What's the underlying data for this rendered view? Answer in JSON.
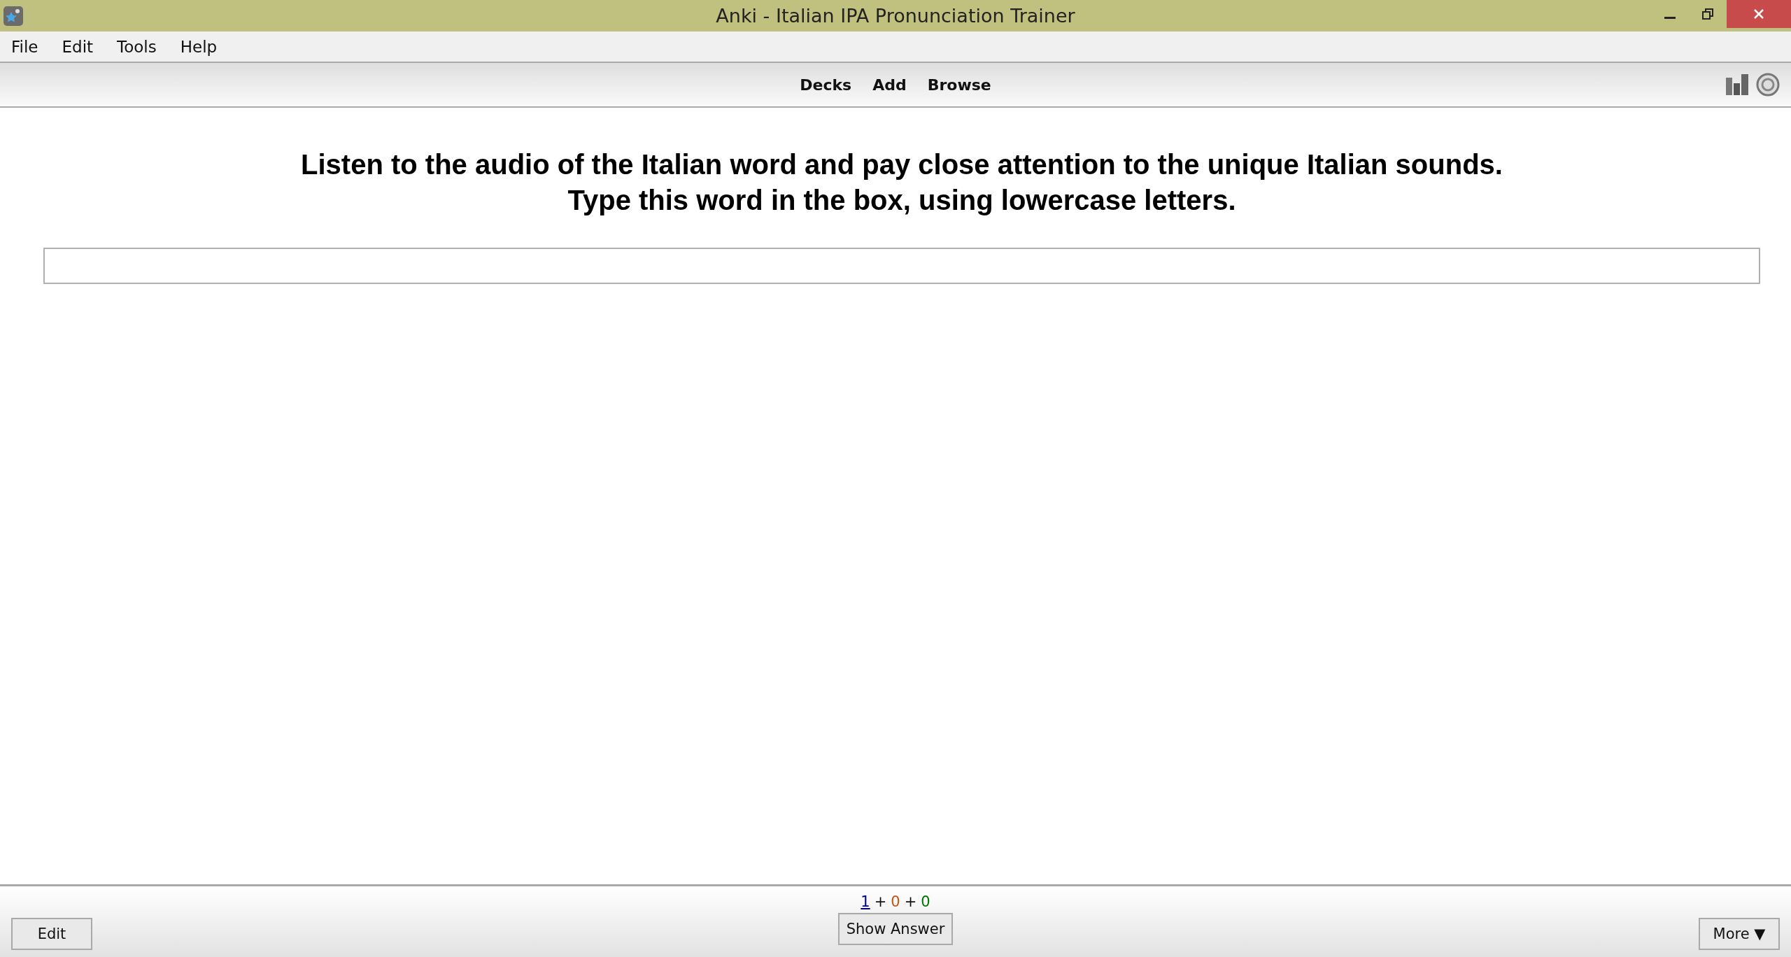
{
  "window": {
    "title": "Anki - Italian IPA Pronunciation Trainer"
  },
  "menu": [
    "File",
    "Edit",
    "Tools",
    "Help"
  ],
  "toolbar": [
    "Decks",
    "Add",
    "Browse"
  ],
  "card": {
    "prompt": [
      "Listen to the audio of the Italian word and pay close attention to the unique Italian sounds.",
      "Type this word in the box, using lowercase letters."
    ]
  },
  "counts": [
    {
      "value": "1",
      "color": "#000080",
      "current": true
    },
    {
      "value": "0",
      "color": "#c35617",
      "current": false
    },
    {
      "value": "0",
      "color": "#007700",
      "current": false
    }
  ],
  "count_separator": "+",
  "bottom_buttons": {
    "left": "Edit",
    "center": "Show Answer",
    "right": "More ▼"
  }
}
